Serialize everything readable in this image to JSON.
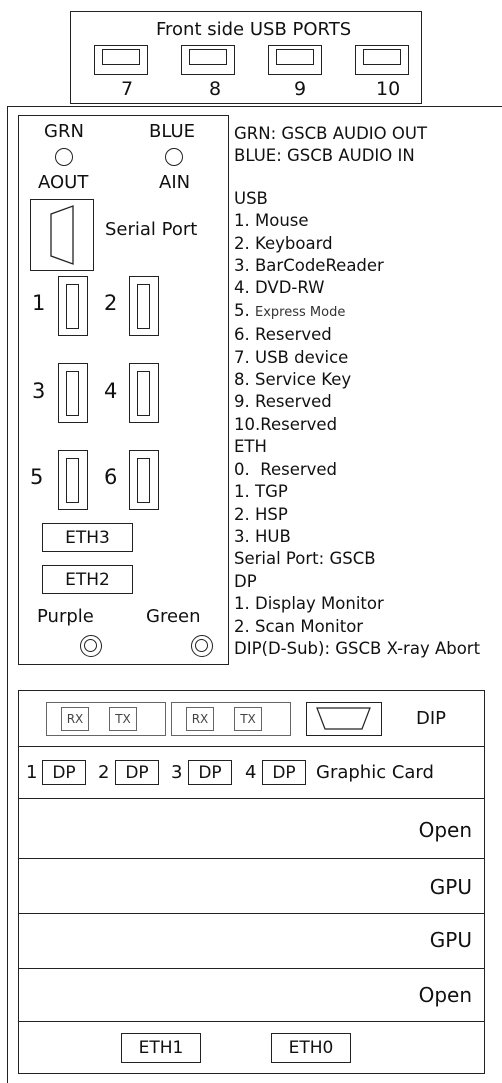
{
  "front_usb": {
    "title": "Front side USB PORTS",
    "ports": [
      "7",
      "8",
      "9",
      "10"
    ]
  },
  "left_panel": {
    "grn": "GRN",
    "blue": "BLUE",
    "aout": "AOUT",
    "ain": "AIN",
    "serial_port": "Serial Port",
    "usb_nums": [
      "1",
      "2",
      "3",
      "4",
      "5",
      "6"
    ],
    "eth3": "ETH3",
    "eth2": "ETH2",
    "purple": "Purple",
    "green": "Green"
  },
  "legend": {
    "audio_out": "GRN: GSCB AUDIO OUT",
    "audio_in": "BLUE: GSCB AUDIO IN",
    "usb_title": "USB",
    "usb_items": [
      "1. Mouse",
      "2. Keyboard",
      "3. BarCodeReader",
      "4. DVD-RW",
      "5.",
      "Express Mode",
      "6. Reserved",
      "7. USB device",
      "8. Service Key",
      "9. Reserved",
      "10.Reserved"
    ],
    "eth_title": "ETH",
    "eth_items": [
      "0.  Reserved",
      "1. TGP",
      "2. HSP",
      "3. HUB"
    ],
    "serial": "Serial Port: GSCB",
    "dp_title": "DP",
    "dp_items": [
      "1. Display Monitor",
      "2. Scan Monitor"
    ],
    "dip": "DIP(D-Sub): GSCB X-ray Abort"
  },
  "bottom": {
    "rx": "RX",
    "tx": "TX",
    "dip": "DIP",
    "dp_nums": [
      "1",
      "2",
      "3",
      "4"
    ],
    "dp": "DP",
    "graphic_card": "Graphic Card",
    "slots": [
      "Open",
      "GPU",
      "GPU",
      "Open"
    ],
    "eth1": "ETH1",
    "eth0": "ETH0"
  }
}
